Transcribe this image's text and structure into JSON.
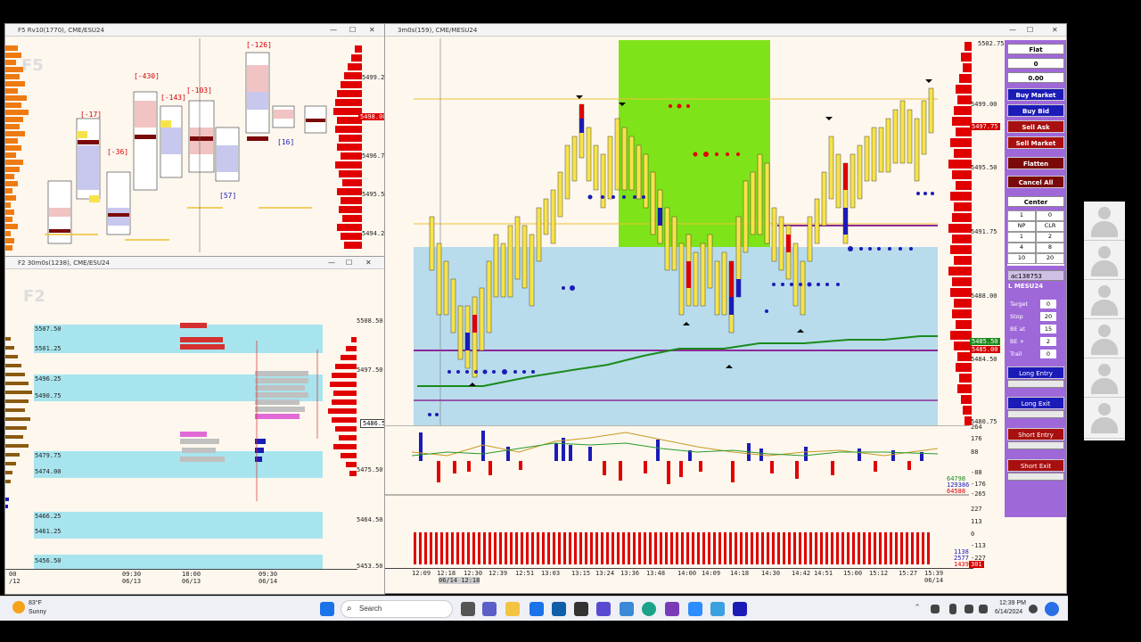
{
  "windows": {
    "f5": {
      "title": "F5 Rv10(1770), CME/ESU24",
      "watermark": "F5",
      "prices": [
        "5499.25",
        "5496.75",
        "5495.50",
        "5494.25"
      ],
      "current_price": "5498.00",
      "deltas": [
        "[-17]",
        "[-36]",
        "[-430]",
        "[-143]",
        "[-103]",
        "[57]",
        "[-126]",
        "[16]"
      ]
    },
    "f2": {
      "title": "F2 30m0s(1238), CME/ESU24",
      "watermark": "F2",
      "prices": [
        "5508.50",
        "5497.50",
        "5475.50",
        "5464.50",
        "5453.50"
      ],
      "current_price": "5486.50",
      "levels": [
        "5507.50",
        "5501.25",
        "5496.25",
        "5490.75",
        "5479.75",
        "5474.00",
        "5466.25",
        "5461.25",
        "5456.50"
      ],
      "time_labels": [
        "00",
        "09:30",
        "18:00",
        "09:30"
      ],
      "date_labels": [
        "/12",
        "06/13",
        "06/13",
        "06/14"
      ]
    },
    "main": {
      "title": "3m0s(159), CME/MESU24",
      "prices": [
        "5502.75",
        "5499.00",
        "5495.50",
        "5491.75",
        "5488.00",
        "5484.50",
        "5480.75"
      ],
      "tags": [
        {
          "text": "5497.75",
          "color": "#d40000"
        },
        {
          "text": "5485.50",
          "color": "#1a8a1a"
        },
        {
          "text": "5485.00",
          "color": "#d40000"
        }
      ],
      "osc1_labels": [
        "264",
        "176",
        "88",
        "-88",
        "-176",
        "-265"
      ],
      "osc1_values": [
        "64798",
        "129386",
        "64588"
      ],
      "osc2_labels": [
        "227",
        "113",
        "0",
        "-113",
        "-227"
      ],
      "osc2_values": [
        "1138",
        "2577",
        "1439"
      ],
      "osc2_tag": "301",
      "times": [
        "12:09",
        "12:18",
        "12:30",
        "12:39",
        "12:51",
        "13:03",
        "13:15",
        "13:24",
        "13:36",
        "13:48",
        "14:00",
        "14:09",
        "14:18",
        "14:30",
        "14:42",
        "14:51",
        "15:00",
        "15:12",
        "15:27",
        "15:39"
      ],
      "date_label": "06/14",
      "cursor_time": "06/14 12:18"
    }
  },
  "sidebar": {
    "status": "Flat",
    "qty": "0",
    "pnl": "0.00",
    "buttons": [
      {
        "label": "Buy Market",
        "color": "#1b1bb8"
      },
      {
        "label": "Buy Bid",
        "color": "#1b1bb8"
      },
      {
        "label": "Sell Ask",
        "color": "#a80f0f"
      },
      {
        "label": "Sell Market",
        "color": "#a80f0f"
      },
      {
        "label": "Flatten",
        "color": "#7a0a0a"
      },
      {
        "label": "Cancel All",
        "color": "#7a0a0a"
      }
    ],
    "center_label": "Center",
    "grid": [
      [
        "1",
        "0"
      ],
      [
        "NP",
        "CLR"
      ],
      [
        "1",
        "2"
      ],
      [
        "4",
        "8"
      ],
      [
        "10",
        "20"
      ]
    ],
    "account": "ac138753",
    "symbol": "L MESU24",
    "params": [
      {
        "label": "Target",
        "value": "0"
      },
      {
        "label": "Stop",
        "value": "20"
      },
      {
        "label": "BE at",
        "value": "15"
      },
      {
        "label": "BE +",
        "value": "2"
      },
      {
        "label": "Trail",
        "value": "0"
      }
    ],
    "strategies": [
      {
        "label": "Long Entry",
        "color": "#1b1bb8"
      },
      {
        "label": "Long Exit",
        "color": "#1b1bb8"
      },
      {
        "label": "Short Entry",
        "color": "#a80f0f"
      },
      {
        "label": "Short Exit",
        "color": "#a80f0f"
      }
    ]
  },
  "taskbar": {
    "weather_temp": "83°F",
    "weather_desc": "Sunny",
    "search_placeholder": "Search",
    "time": "12:39 PM",
    "date": "6/14/2024"
  },
  "colors": {
    "buy": "#1b1bb8",
    "sell": "#a80f0f",
    "accent": "#9f68d8"
  }
}
